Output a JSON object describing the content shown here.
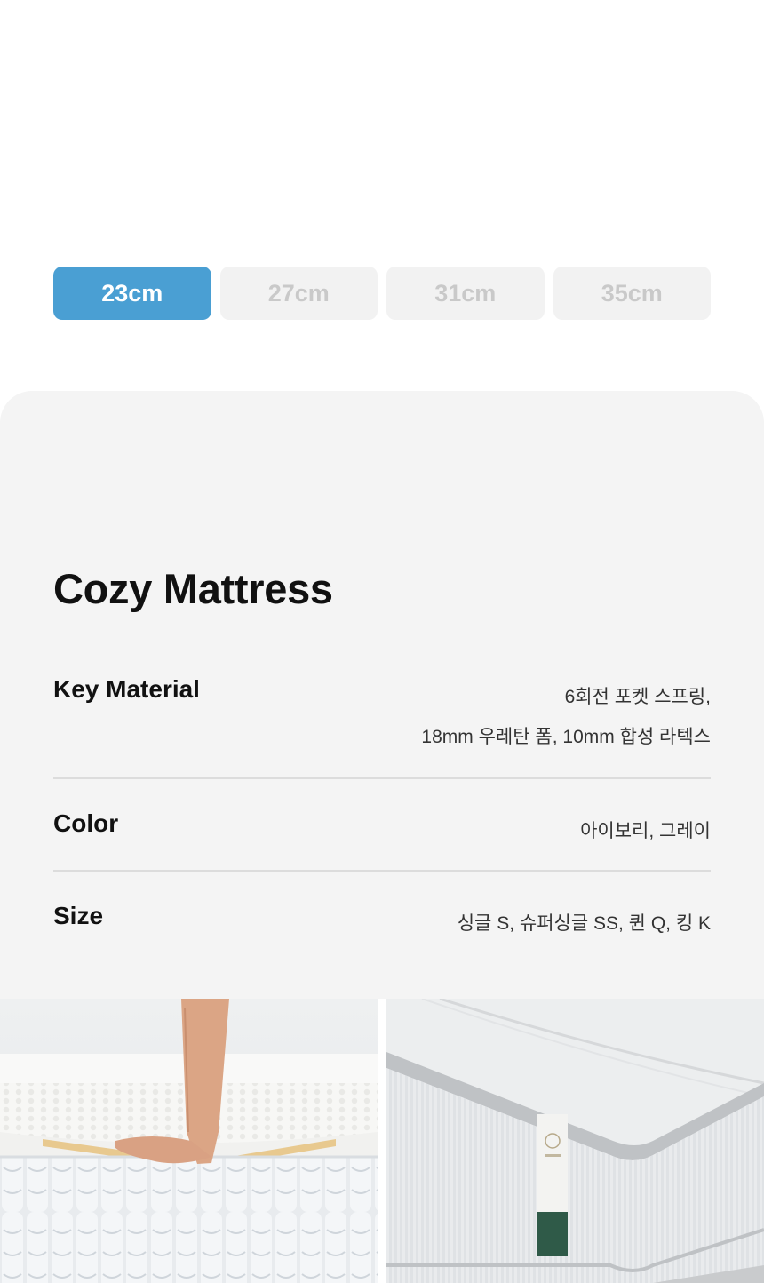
{
  "size_tabs": [
    {
      "label": "23cm",
      "selected": true
    },
    {
      "label": "27cm",
      "selected": false
    },
    {
      "label": "31cm",
      "selected": false
    },
    {
      "label": "35cm",
      "selected": false
    }
  ],
  "colors": {
    "accent": "#4a9fd3",
    "tab_inactive_bg": "#f2f2f2",
    "tab_inactive_text": "#c9c9c9",
    "panel_bg": "#f4f4f4"
  },
  "product": {
    "title": "Cozy Mattress",
    "specs": [
      {
        "label": "Key Material",
        "value_lines": [
          "6회전 포켓 스프링,",
          "18mm 우레탄 폼, 10mm 합성 라텍스"
        ]
      },
      {
        "label": "Color",
        "value_lines": [
          "아이보리, 그레이"
        ]
      },
      {
        "label": "Size",
        "value_lines": [
          "싱글 S, 슈퍼싱글 SS, 퀸 Q, 킹 K"
        ]
      }
    ]
  },
  "images": [
    {
      "name": "mattress-layers-hand-photo"
    },
    {
      "name": "mattress-corner-photo"
    }
  ]
}
